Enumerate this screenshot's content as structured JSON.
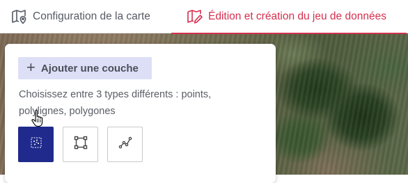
{
  "tabs": [
    {
      "label": "Configuration de la carte",
      "icon": "map-pin-icon",
      "active": false
    },
    {
      "label": "Édition et création du jeu de données",
      "icon": "map-edit-icon",
      "active": true
    }
  ],
  "colors": {
    "accent": "#d4304f",
    "primary_button": "#1f2a8c",
    "add_layer_bg": "#dddff7"
  },
  "panel": {
    "add_layer_label": "Ajouter une couche",
    "help_text": "Choisissez entre 3 types différents : points, polylignes, polygones",
    "types": [
      {
        "name": "points",
        "icon": "points-icon",
        "selected": true
      },
      {
        "name": "polygones",
        "icon": "polygon-icon",
        "selected": false
      },
      {
        "name": "polylignes",
        "icon": "polyline-icon",
        "selected": false
      }
    ]
  },
  "cursor": "hand-pointer-icon"
}
